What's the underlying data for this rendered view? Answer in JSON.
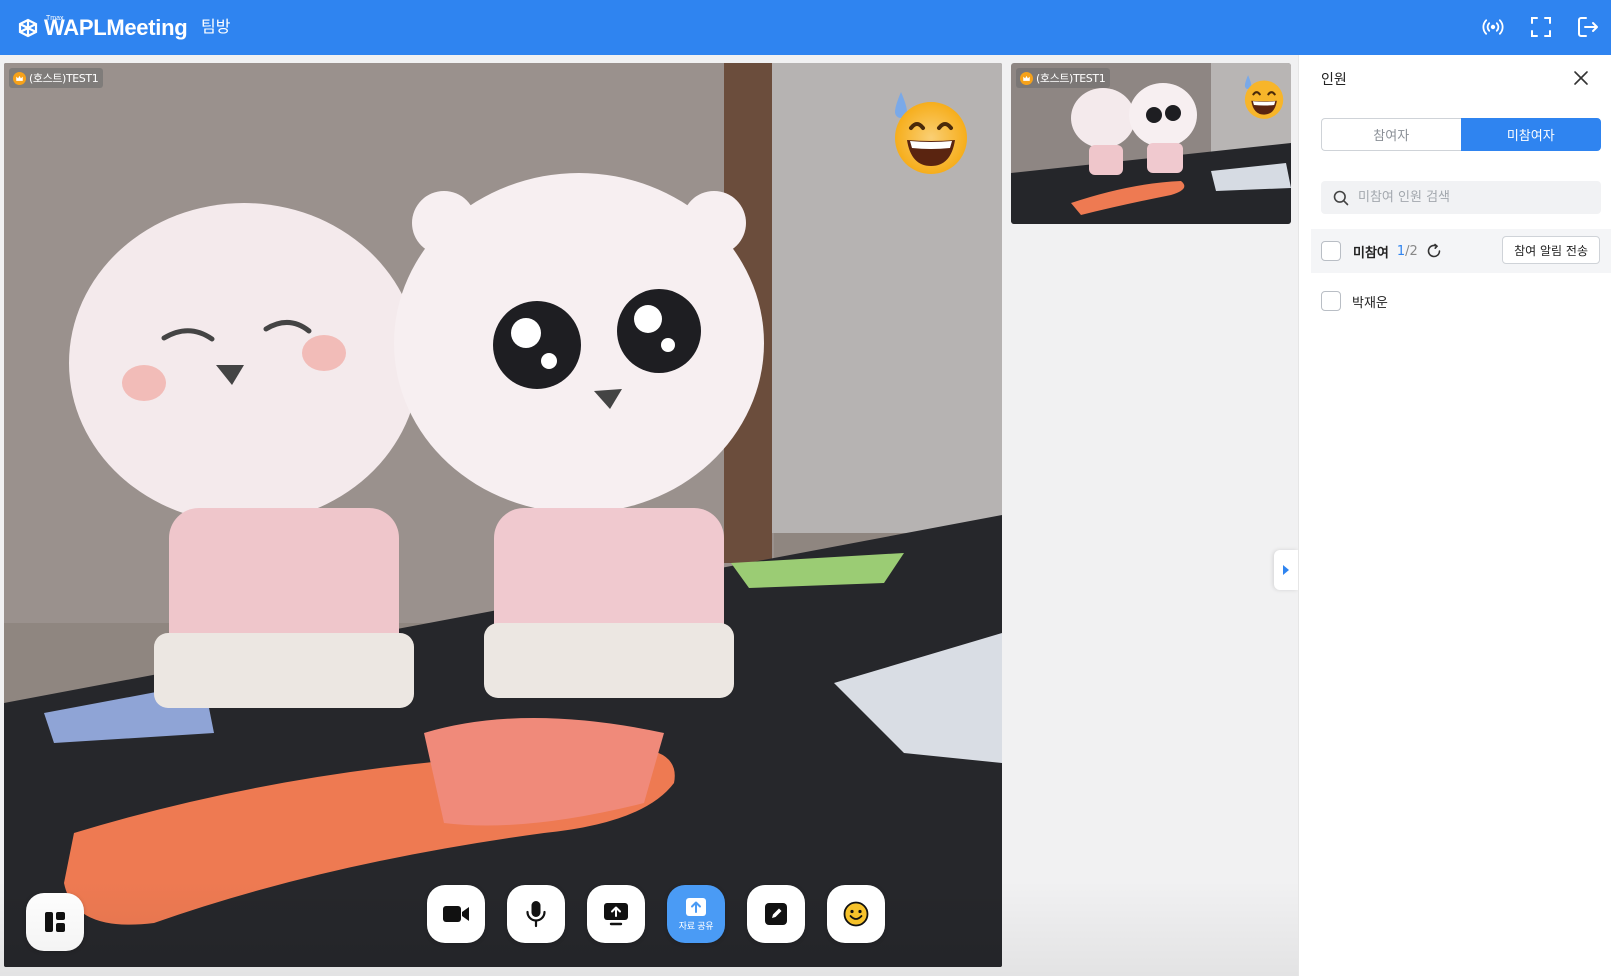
{
  "header": {
    "logo_sup": "Tmax",
    "logo_text": "WAPLMeeting",
    "room_name": "팀방",
    "icons": [
      "broadcast-icon",
      "fullscreen-icon",
      "exit-icon"
    ]
  },
  "stage": {
    "main_tile": {
      "name_tag": "(호스트)TEST1",
      "reaction_emoji": "sweat-smile-emoji"
    },
    "thumb_tile": {
      "name_tag": "(호스트)TEST1",
      "reaction_emoji": "sweat-smile-emoji"
    }
  },
  "toolbar": {
    "layout_icon": "layout-icon",
    "buttons": [
      {
        "icon": "video-camera-icon"
      },
      {
        "icon": "microphone-icon"
      },
      {
        "icon": "screen-share-icon"
      },
      {
        "icon": "upload-icon",
        "label": "자료 공유",
        "active": true
      },
      {
        "icon": "pen-icon"
      },
      {
        "icon": "smile-icon"
      }
    ]
  },
  "panel": {
    "title": "인원",
    "tabs": [
      {
        "label": "참여자",
        "active": false
      },
      {
        "label": "미참여자",
        "active": true
      }
    ],
    "search": {
      "placeholder": "미참여 인원 검색",
      "value": ""
    },
    "group": {
      "label": "미참여",
      "count_current": "1",
      "count_total": "/2",
      "notify_button": "참여 알림 전송",
      "checked": false
    },
    "members": [
      {
        "name": "박재운",
        "checked": false
      }
    ]
  },
  "colors": {
    "brand": "#2f84f0",
    "active_tool": "#4a9bf5",
    "stage_bg": "#f1f1f2"
  }
}
